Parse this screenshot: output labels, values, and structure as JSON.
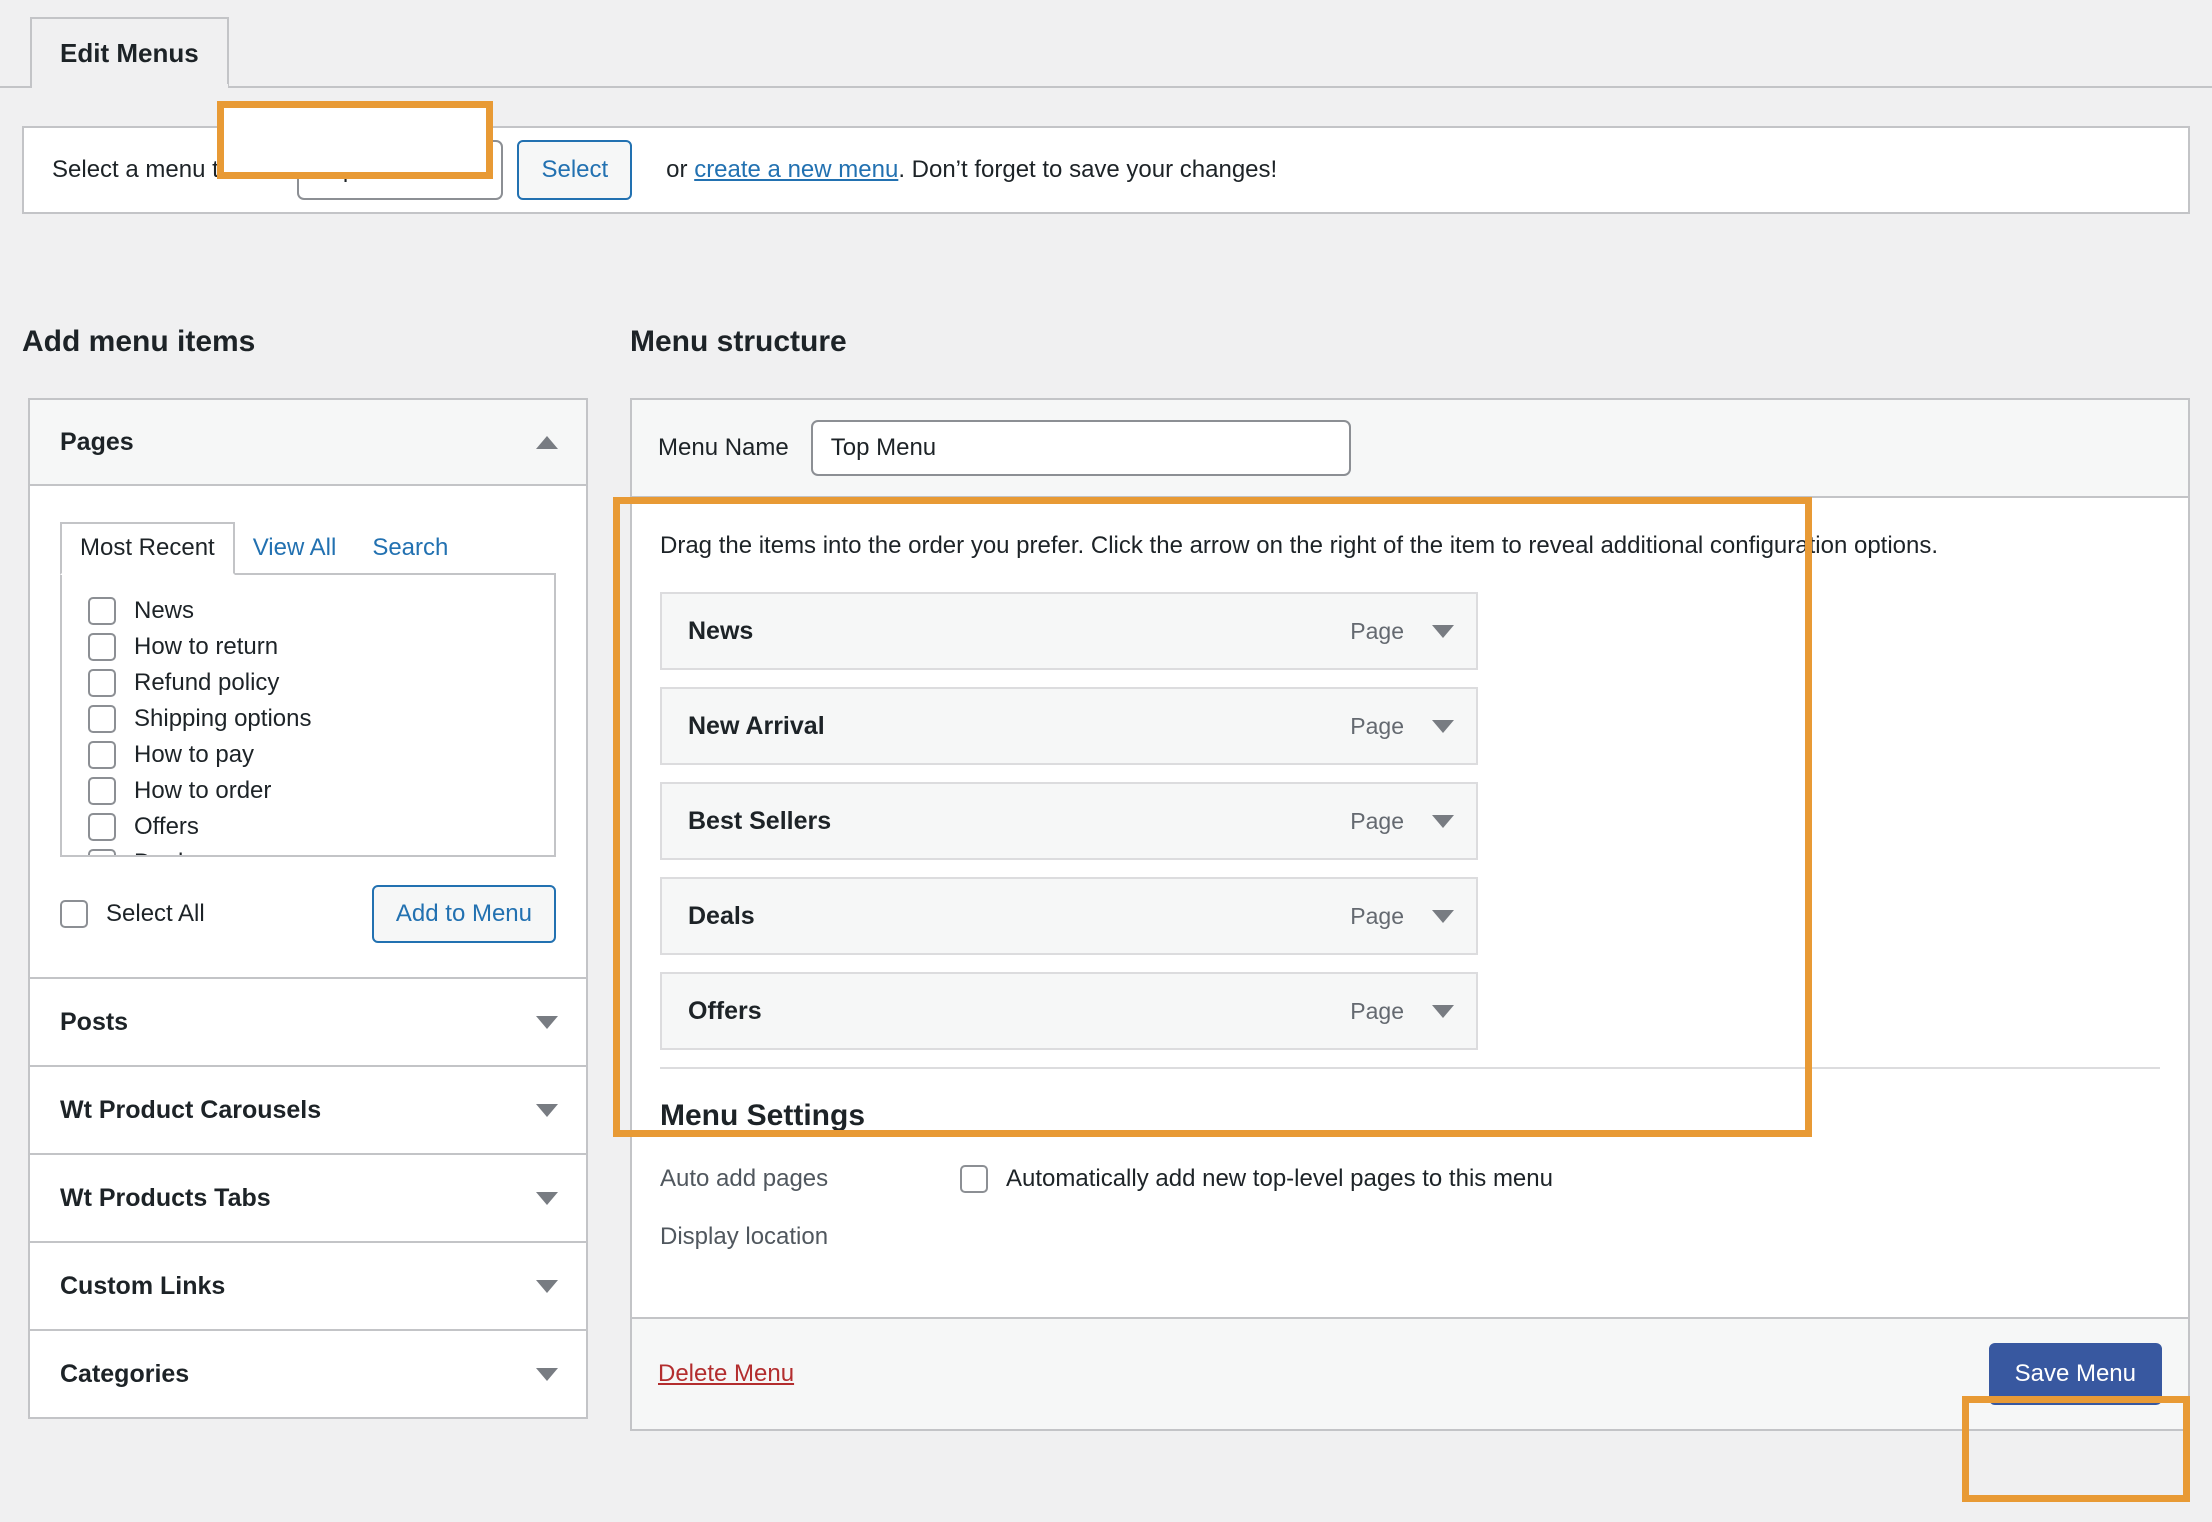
{
  "tab": {
    "label": "Edit Menus"
  },
  "select_bar": {
    "label": "Select a menu to edit",
    "dropdown_value": "Top Menu",
    "dropdown_icon": "chevron-down-icon",
    "select_button": "Select",
    "tail_prefix": "or ",
    "create_link": "create a new menu",
    "tail_suffix": ". Don’t forget to save your changes!"
  },
  "add_items": {
    "heading": "Add menu items",
    "panels": [
      {
        "title": "Pages",
        "state": "expanded",
        "icon": "chevron-up-icon"
      },
      {
        "title": "Posts",
        "state": "collapsed",
        "icon": "chevron-down-icon"
      },
      {
        "title": "Wt Product Carousels",
        "state": "collapsed",
        "icon": "chevron-down-icon"
      },
      {
        "title": "Wt Products Tabs",
        "state": "collapsed",
        "icon": "chevron-down-icon"
      },
      {
        "title": "Custom Links",
        "state": "collapsed",
        "icon": "chevron-down-icon"
      },
      {
        "title": "Categories",
        "state": "collapsed",
        "icon": "chevron-down-icon"
      }
    ],
    "pages_tabs": [
      {
        "label": "Most Recent",
        "active": true
      },
      {
        "label": "View All",
        "active": false
      },
      {
        "label": "Search",
        "active": false
      }
    ],
    "pages_list": [
      {
        "label": "News",
        "checked": false
      },
      {
        "label": "How to return",
        "checked": false
      },
      {
        "label": "Refund policy",
        "checked": false
      },
      {
        "label": "Shipping options",
        "checked": false
      },
      {
        "label": "How to pay",
        "checked": false
      },
      {
        "label": "How to order",
        "checked": false
      },
      {
        "label": "Offers",
        "checked": false
      },
      {
        "label": "Deals",
        "checked": false
      }
    ],
    "select_all_label": "Select All",
    "add_to_menu_button": "Add to Menu"
  },
  "menu_structure": {
    "heading": "Menu structure",
    "menu_name_label": "Menu Name",
    "menu_name_value": "Top Menu",
    "hint": "Drag the items into the order you prefer. Click the arrow on the right of the item to reveal additional configuration options.",
    "items": [
      {
        "title": "News",
        "type": "Page",
        "arrow": "chevron-down-icon"
      },
      {
        "title": "New Arrival",
        "type": "Page",
        "arrow": "chevron-down-icon"
      },
      {
        "title": "Best Sellers",
        "type": "Page",
        "arrow": "chevron-down-icon"
      },
      {
        "title": "Deals",
        "type": "Page",
        "arrow": "chevron-down-icon"
      },
      {
        "title": "Offers",
        "type": "Page",
        "arrow": "chevron-down-icon"
      }
    ]
  },
  "menu_settings": {
    "heading": "Menu Settings",
    "auto_add_label": "Auto add pages",
    "auto_add_checkbox_label": "Automatically add new top-level pages to this menu",
    "auto_add_checked": false,
    "display_location_label": "Display location"
  },
  "footer": {
    "delete_link": "Delete Menu",
    "save_button": "Save Menu"
  },
  "colors": {
    "highlight": "#e89a35",
    "primary_button": "#3858a0",
    "link": "#2271b1",
    "danger": "#b32d2e",
    "page_background": "#f0f0f1"
  }
}
